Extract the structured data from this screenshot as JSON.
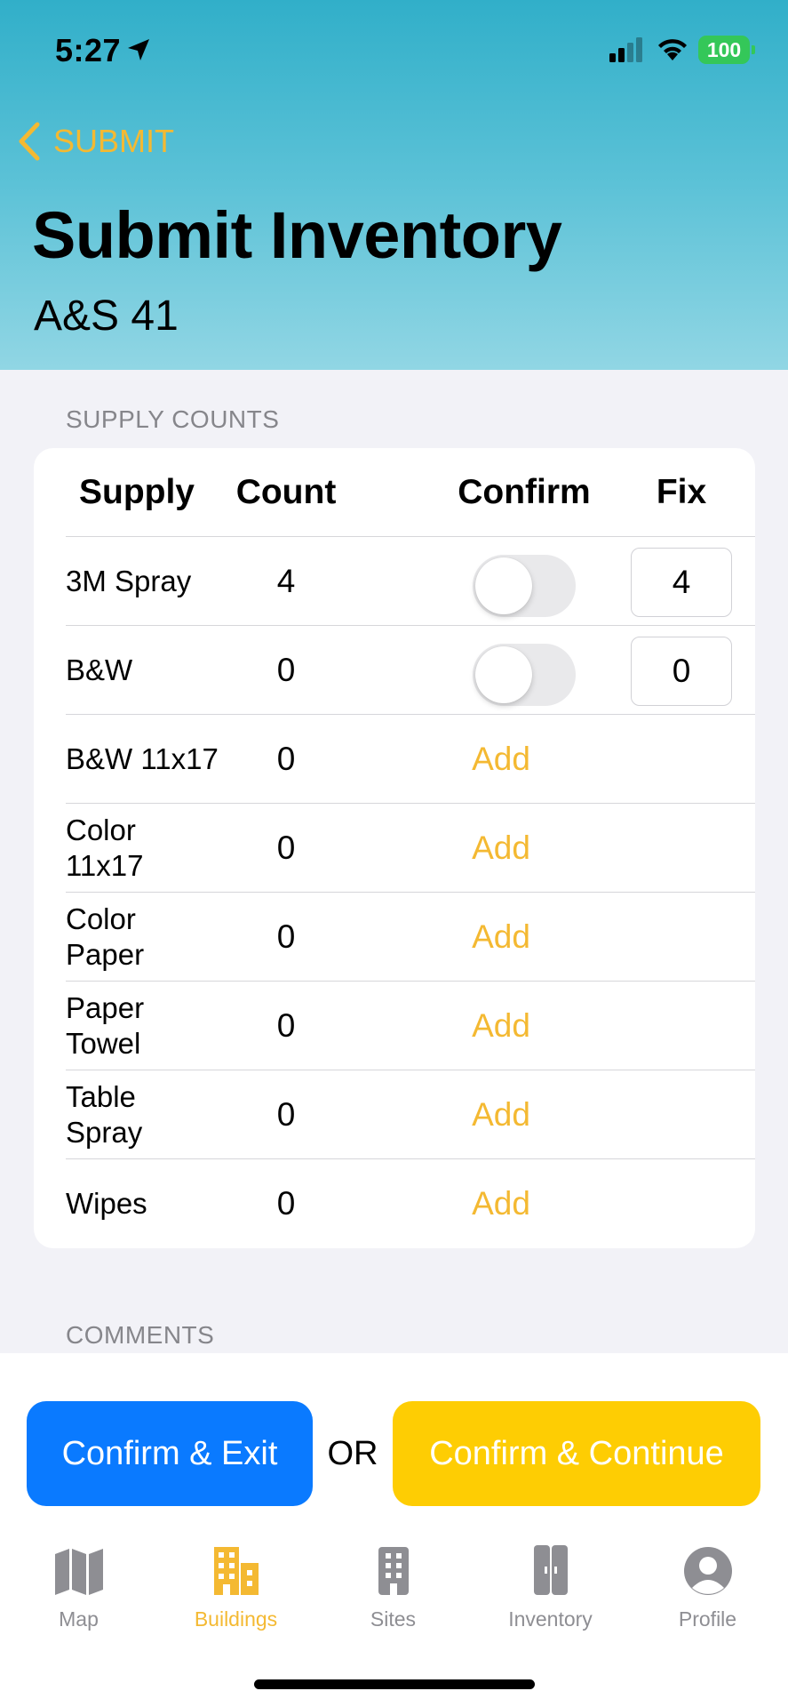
{
  "status_bar": {
    "time": "5:27",
    "battery": "100",
    "battery_color": "#34c759"
  },
  "nav": {
    "back_label": "SUBMIT"
  },
  "header": {
    "title": "Submit Inventory",
    "subtitle": "A&S 41"
  },
  "supply_counts": {
    "section_label": "SUPPLY COUNTS",
    "columns": {
      "supply": "Supply",
      "count": "Count",
      "confirm": "Confirm",
      "fix": "Fix"
    },
    "rows": [
      {
        "name": "3M Spray",
        "count": "4",
        "confirm_on": false,
        "fix": "4"
      },
      {
        "name": "B&W",
        "count": "0",
        "confirm_on": false,
        "fix": "0"
      },
      {
        "name": "B&W 11x17",
        "count": "0",
        "action": "Add"
      },
      {
        "name": "Color 11x17",
        "count": "0",
        "action": "Add"
      },
      {
        "name": "Color Paper",
        "count": "0",
        "action": "Add"
      },
      {
        "name": "Paper Towel",
        "count": "0",
        "action": "Add"
      },
      {
        "name": "Table Spray",
        "count": "0",
        "action": "Add"
      },
      {
        "name": "Wipes",
        "count": "0",
        "action": "Add"
      }
    ]
  },
  "comments": {
    "section_label": "COMMENTS"
  },
  "actions": {
    "confirm_exit": "Confirm & Exit",
    "or": "OR",
    "confirm_continue": "Confirm & Continue"
  },
  "tabs": [
    {
      "label": "Map",
      "icon": "map-icon",
      "active": false
    },
    {
      "label": "Buildings",
      "icon": "buildings-icon",
      "active": true
    },
    {
      "label": "Sites",
      "icon": "sites-icon",
      "active": false
    },
    {
      "label": "Inventory",
      "icon": "inventory-icon",
      "active": false
    },
    {
      "label": "Profile",
      "icon": "profile-icon",
      "active": false
    }
  ],
  "colors": {
    "accent": "#f4b932",
    "header_gradient_top": "#31afc9",
    "header_gradient_bottom": "#91d6e4",
    "exit_button": "#0a7aff",
    "continue_button": "#fecd03",
    "inactive_tab": "#8e8e93"
  }
}
